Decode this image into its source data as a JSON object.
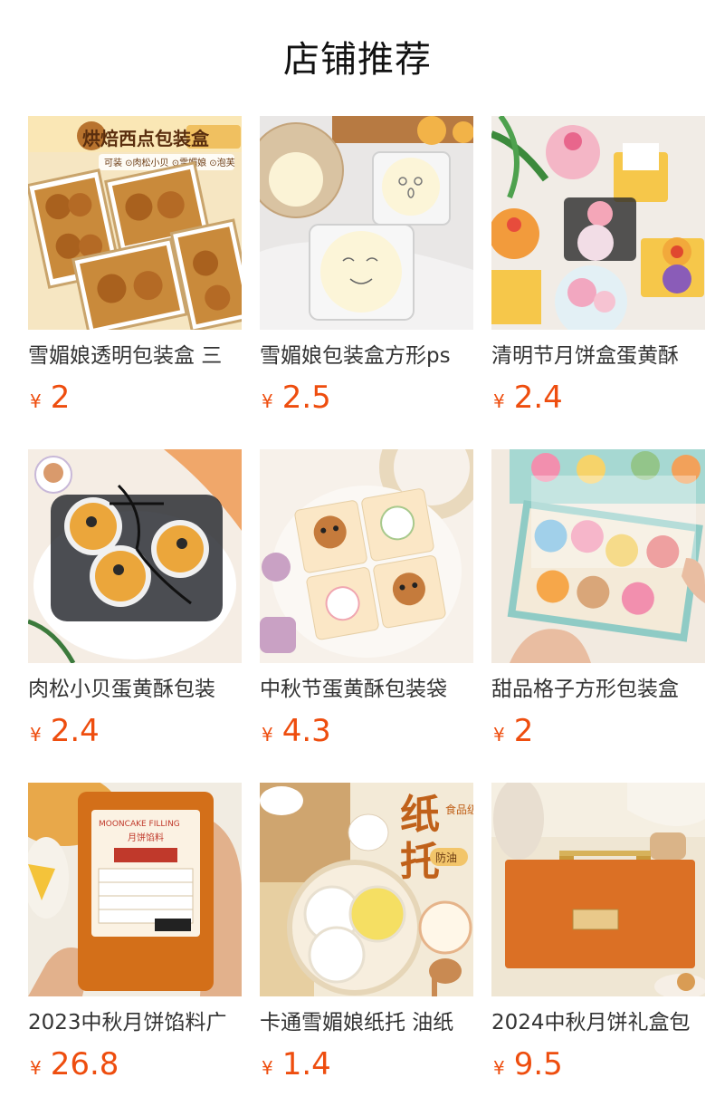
{
  "section": {
    "title": "店铺推荐"
  },
  "products": [
    {
      "name": "雪媚娘透明包装盒 三",
      "currency": "¥",
      "price": "2",
      "image_icon": "pastry-box-product-image",
      "image_text": {
        "banner": "烘焙西点包装盒",
        "tags": "可装 ⊙肉松小贝 ⊙雪媚娘 ⊙泡芙"
      }
    },
    {
      "name": "雪媚娘包装盒方形ps",
      "currency": "¥",
      "price": "2.5",
      "image_icon": "snow-skin-box-product-image",
      "image_text": {}
    },
    {
      "name": "清明节月饼盒蛋黄酥",
      "currency": "¥",
      "price": "2.4",
      "image_icon": "mooncake-box-product-image",
      "image_text": {}
    },
    {
      "name": "肉松小贝蛋黄酥包装",
      "currency": "¥",
      "price": "2.4",
      "image_icon": "egg-yolk-pastry-product-image",
      "image_text": {}
    },
    {
      "name": "中秋节蛋黄酥包装袋",
      "currency": "¥",
      "price": "4.3",
      "image_icon": "cartoon-bag-product-image",
      "image_text": {}
    },
    {
      "name": "甜品格子方形包装盒",
      "currency": "¥",
      "price": "2",
      "image_icon": "dessert-grid-box-product-image",
      "image_text": {}
    },
    {
      "name": "2023中秋月饼馅料广",
      "currency": "¥",
      "price": "26.8",
      "image_icon": "mooncake-filling-product-image",
      "image_text": {
        "pack_en": "MOONCAKE FILLING",
        "pack_cn": "月饼馅料"
      }
    },
    {
      "name": "卡通雪媚娘纸托 油纸",
      "currency": "¥",
      "price": "1.4",
      "image_icon": "paper-cups-product-image",
      "image_text": {
        "big1": "纸",
        "big2": "托",
        "small": "食品级",
        "badge": "防油"
      }
    },
    {
      "name": "2024中秋月饼礼盒包",
      "currency": "¥",
      "price": "9.5",
      "image_icon": "gift-box-product-image",
      "image_text": {}
    }
  ],
  "colors": {
    "price": "#ee4d0e",
    "name": "#333333",
    "title": "#111111"
  }
}
